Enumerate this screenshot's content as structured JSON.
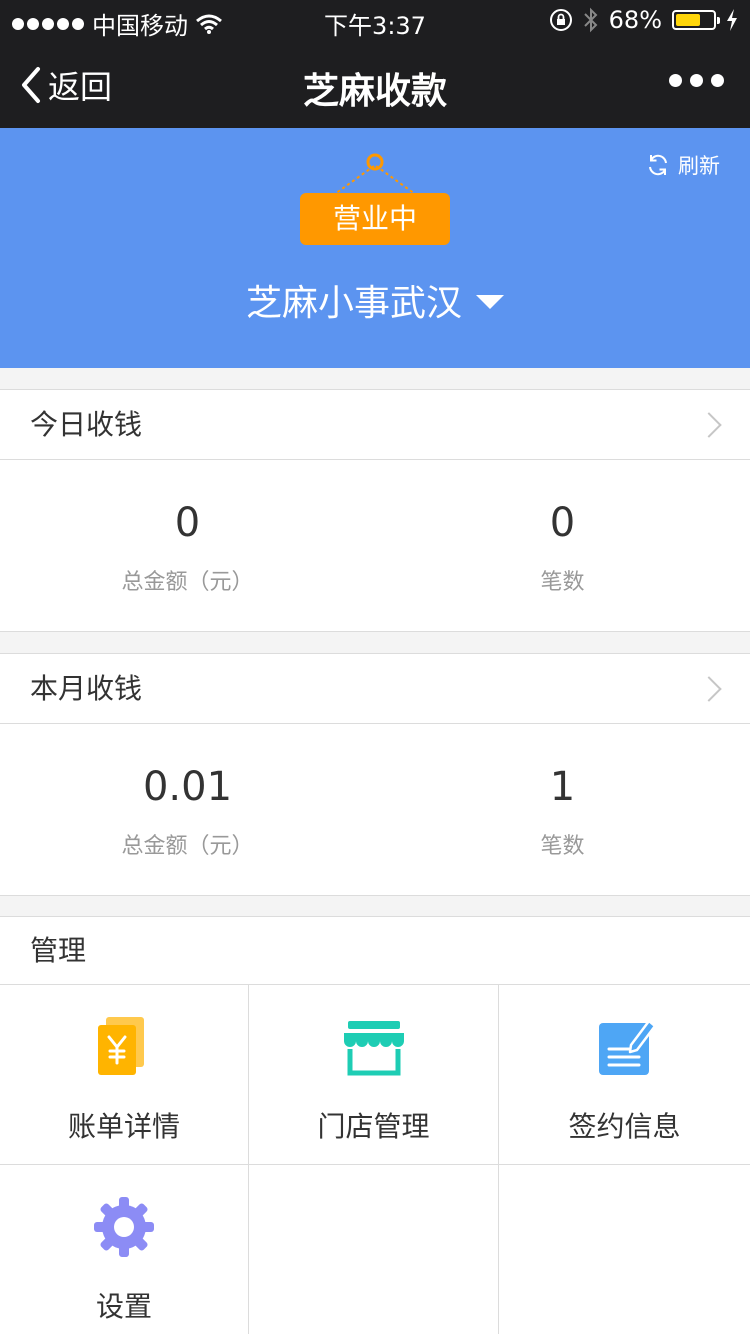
{
  "status_bar": {
    "carrier": "中国移动",
    "time": "下午3:37",
    "battery": "68%",
    "battery_level": 0.68
  },
  "nav": {
    "back_label": "返回",
    "title": "芝麻收款"
  },
  "header": {
    "refresh_label": "刷新",
    "status_sign": "营业中",
    "shop_name": "芝麻小事武汉"
  },
  "today": {
    "title": "今日收钱",
    "amount": "0",
    "amount_label": "总金额（元）",
    "count": "0",
    "count_label": "笔数"
  },
  "month": {
    "title": "本月收钱",
    "amount": "0.01",
    "amount_label": "总金额（元）",
    "count": "1",
    "count_label": "笔数"
  },
  "manage": {
    "title": "管理",
    "items": [
      {
        "label": "账单详情",
        "icon": "bill-icon",
        "color": "#ffb400"
      },
      {
        "label": "门店管理",
        "icon": "store-icon",
        "color": "#1ecdb4"
      },
      {
        "label": "签约信息",
        "icon": "contract-icon",
        "color": "#4ea6f5"
      },
      {
        "label": "设置",
        "icon": "gear-icon",
        "color": "#8c8cf5"
      }
    ]
  }
}
